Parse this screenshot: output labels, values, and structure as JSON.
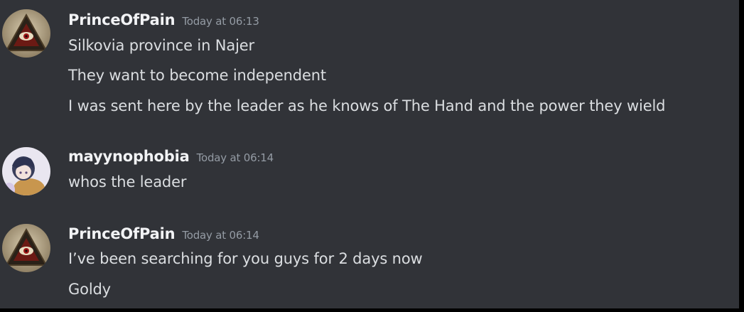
{
  "messages": [
    {
      "username": "PrinceOfPain",
      "timestamp": "Today at 06:13",
      "avatar_icon": "triangle-eye-avatar",
      "lines": [
        "Silkovia province in Najer",
        "They want to become independent",
        "I was sent here by the leader as he knows of The Hand and the power they wield"
      ]
    },
    {
      "username": "mayynophobia",
      "timestamp": "Today at 06:14",
      "avatar_icon": "anime-character-avatar",
      "lines": [
        "whos the leader"
      ]
    },
    {
      "username": "PrinceOfPain",
      "timestamp": "Today at 06:14",
      "avatar_icon": "triangle-eye-avatar",
      "lines": [
        "I’ve been searching for you guys for 2 days now",
        "Goldy"
      ]
    }
  ],
  "colors": {
    "background": "#313338",
    "username": "#f2f3f5",
    "timestamp": "#949ba4",
    "message_text": "#dbdee1"
  }
}
